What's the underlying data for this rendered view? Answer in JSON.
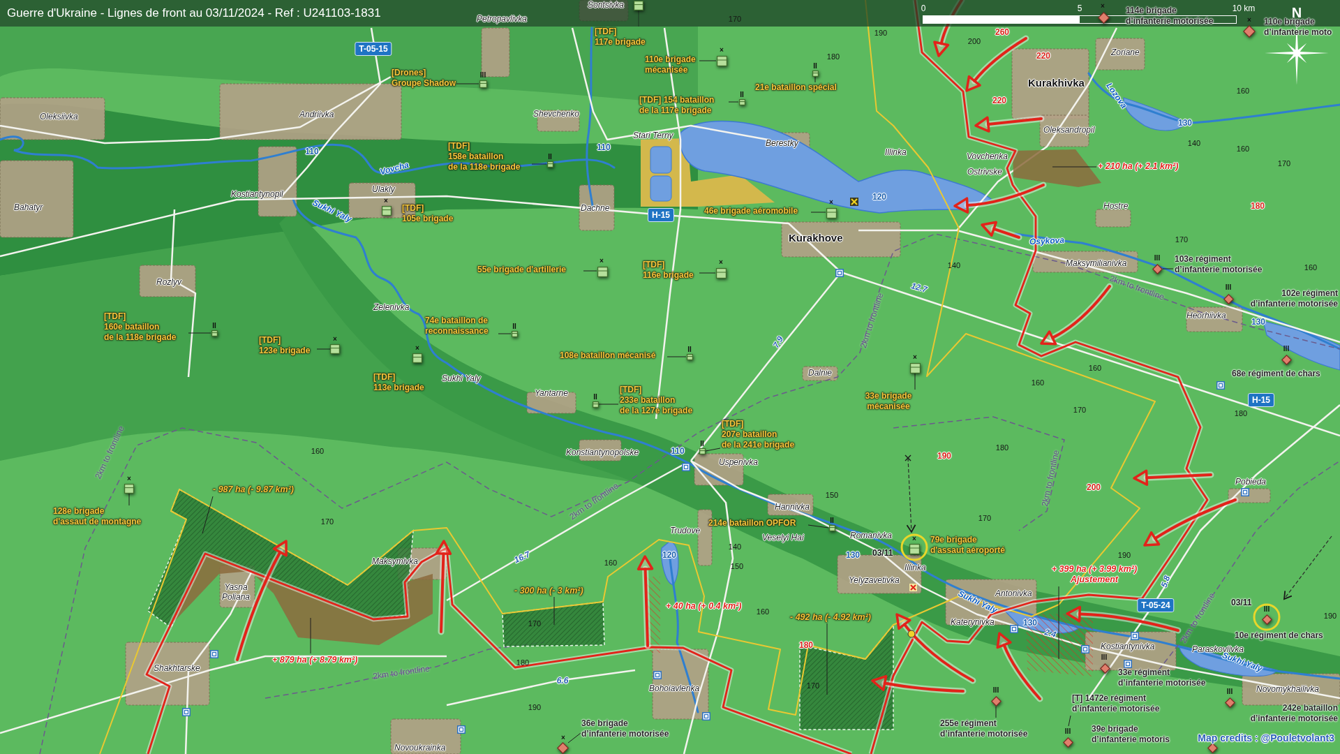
{
  "title": "Guerre d'Ukraine - Lignes de front au 03/11/2024 - Ref : U241103-1831",
  "scale_bar": {
    "ticks": [
      "0",
      "5",
      "10 km"
    ]
  },
  "compass": {
    "label": "N"
  },
  "places": [
    {
      "name": "Sontsivka",
      "kind": "village"
    },
    {
      "name": "Petropavlivka",
      "kind": "village"
    },
    {
      "name": "Oleksiivka",
      "kind": "village"
    },
    {
      "name": "Andriivka",
      "kind": "village"
    },
    {
      "name": "Shevchenko",
      "kind": "village"
    },
    {
      "name": "Stari Terny",
      "kind": "village"
    },
    {
      "name": "Berestky",
      "kind": "village"
    },
    {
      "name": "Illinka",
      "kind": "village"
    },
    {
      "name": "Zoriane",
      "kind": "village"
    },
    {
      "name": "Kurakhivka",
      "kind": "city"
    },
    {
      "name": "Oleksandropil",
      "kind": "village"
    },
    {
      "name": "Vovchenka",
      "kind": "village"
    },
    {
      "name": "Ostrivske",
      "kind": "village"
    },
    {
      "name": "Ulakly",
      "kind": "village"
    },
    {
      "name": "Kostiantynopil",
      "kind": "village"
    },
    {
      "name": "Bahatyr",
      "kind": "village"
    },
    {
      "name": "Dachne",
      "kind": "village"
    },
    {
      "name": "Hostre",
      "kind": "village"
    },
    {
      "name": "Kurakhove",
      "kind": "city"
    },
    {
      "name": "Maksymilianivka",
      "kind": "village"
    },
    {
      "name": "Rozlyv",
      "kind": "village"
    },
    {
      "name": "Zelenivka",
      "kind": "village"
    },
    {
      "name": "Heorhiivka",
      "kind": "village"
    },
    {
      "name": "Dalnie",
      "kind": "village"
    },
    {
      "name": "Sukhi Yaly",
      "kind": "village"
    },
    {
      "name": "Yantarne",
      "kind": "village"
    },
    {
      "name": "Konstiantynopolske",
      "kind": "village"
    },
    {
      "name": "Uspenivka",
      "kind": "village"
    },
    {
      "name": "Pobieda",
      "kind": "village"
    },
    {
      "name": "Hannivka",
      "kind": "village"
    },
    {
      "name": "Trudove",
      "kind": "village"
    },
    {
      "name": "Romanivka",
      "kind": "village"
    },
    {
      "name": "Veselyi Hai",
      "kind": "village"
    },
    {
      "name": "Maksymivka",
      "kind": "village"
    },
    {
      "name": "Illinka",
      "kind": "village"
    },
    {
      "name": "Yelyzavetivka",
      "kind": "village"
    },
    {
      "name": "Yasna Poliana",
      "kind": "village"
    },
    {
      "name": "Antonivka",
      "kind": "village"
    },
    {
      "name": "Katerynivka",
      "kind": "village"
    },
    {
      "name": "Kostiantynivka",
      "kind": "village"
    },
    {
      "name": "Paraskoviivka",
      "kind": "village"
    },
    {
      "name": "Shakhtarske",
      "kind": "village"
    },
    {
      "name": "Bohoiavlenka",
      "kind": "village"
    },
    {
      "name": "Novomykhailivka",
      "kind": "village"
    },
    {
      "name": "Novoukrainka",
      "kind": "village"
    }
  ],
  "elevations": [
    {
      "value": "170",
      "kind": "contour"
    },
    {
      "value": "190",
      "kind": "contour"
    },
    {
      "value": "260",
      "kind": "spot"
    },
    {
      "value": "200",
      "kind": "contour"
    },
    {
      "value": "220",
      "kind": "spot"
    },
    {
      "value": "180",
      "kind": "contour"
    },
    {
      "value": "160",
      "kind": "contour"
    },
    {
      "value": "220",
      "kind": "spot"
    },
    {
      "value": "140",
      "kind": "contour"
    },
    {
      "value": "160",
      "kind": "contour"
    },
    {
      "value": "170",
      "kind": "contour"
    },
    {
      "value": "180",
      "kind": "spot"
    },
    {
      "value": "170",
      "kind": "contour"
    },
    {
      "value": "140",
      "kind": "contour"
    },
    {
      "value": "160",
      "kind": "contour"
    },
    {
      "value": "160",
      "kind": "contour"
    },
    {
      "value": "160",
      "kind": "contour"
    },
    {
      "value": "170",
      "kind": "contour"
    },
    {
      "value": "180",
      "kind": "contour"
    },
    {
      "value": "180",
      "kind": "contour"
    },
    {
      "value": "160",
      "kind": "contour"
    },
    {
      "value": "190",
      "kind": "spot"
    },
    {
      "value": "200",
      "kind": "spot"
    },
    {
      "value": "150",
      "kind": "contour"
    },
    {
      "value": "170",
      "kind": "contour"
    },
    {
      "value": "170",
      "kind": "contour"
    },
    {
      "value": "140",
      "kind": "contour"
    },
    {
      "value": "190",
      "kind": "contour"
    },
    {
      "value": "160",
      "kind": "contour"
    },
    {
      "value": "150",
      "kind": "contour"
    },
    {
      "value": "160",
      "kind": "contour"
    },
    {
      "value": "190",
      "kind": "contour"
    },
    {
      "value": "170",
      "kind": "contour"
    },
    {
      "value": "180",
      "kind": "spot"
    },
    {
      "value": "180",
      "kind": "contour"
    },
    {
      "value": "170",
      "kind": "contour"
    },
    {
      "value": "190",
      "kind": "contour"
    }
  ],
  "road_numbers": [
    {
      "label": "T-05-15",
      "kind": "shield"
    },
    {
      "label": "130",
      "kind": "local"
    },
    {
      "label": "110",
      "kind": "local"
    },
    {
      "label": "110",
      "kind": "local"
    },
    {
      "label": "120",
      "kind": "local"
    },
    {
      "label": "H-15",
      "kind": "shield"
    },
    {
      "label": "12.7",
      "kind": "distance"
    },
    {
      "label": "130",
      "kind": "local"
    },
    {
      "label": "7.9",
      "kind": "distance"
    },
    {
      "label": "H-15",
      "kind": "shield"
    },
    {
      "label": "110",
      "kind": "local"
    },
    {
      "label": "120",
      "kind": "local"
    },
    {
      "label": "130",
      "kind": "local"
    },
    {
      "label": "16.7",
      "kind": "distance"
    },
    {
      "label": "5.8",
      "kind": "distance"
    },
    {
      "label": "T-05-24",
      "kind": "shield"
    },
    {
      "label": "130",
      "kind": "local"
    },
    {
      "label": "2.4",
      "kind": "distance"
    },
    {
      "label": "6.6",
      "kind": "distance"
    }
  ],
  "rivers": [
    {
      "label": "Lozova"
    },
    {
      "label": "Vovcha"
    },
    {
      "label": "Sukhi Yaly"
    },
    {
      "label": "Osykova"
    },
    {
      "label": "Sukhi Yaly"
    },
    {
      "label": "Sukhi Yaly"
    }
  ],
  "frontline_labels": [
    "2km to frontline",
    "2km to frontline",
    "2km to frontline",
    "2km to frontline",
    "2km to frontline",
    "2km to frontline",
    "2km to frontline"
  ],
  "units": [
    {
      "kind": "russia",
      "echelon": "×",
      "lines": [
        "114e brigade",
        "d’infanterie motorisée"
      ],
      "highlighted": false
    },
    {
      "kind": "russia",
      "echelon": "×",
      "lines": [
        "110e brigade",
        "d’infanterie moto"
      ],
      "highlighted": false
    },
    {
      "kind": "ukraine",
      "lines": [
        "[TDF]",
        "117e brigade"
      ],
      "highlighted": false
    },
    {
      "kind": "ukraine",
      "echelon": "×",
      "lines": [
        "110e brigade",
        "mécanisée"
      ],
      "highlighted": false
    },
    {
      "kind": "ukraine",
      "echelon": "III",
      "lines": [
        "[Drones]",
        "Groupe Shadow"
      ],
      "highlighted": false
    },
    {
      "kind": "ukraine",
      "echelon": "II",
      "lines": [
        "21e bataillon spécial"
      ],
      "highlighted": false
    },
    {
      "kind": "ukraine",
      "echelon": "II",
      "lines": [
        "[TDF] 154 bataillon",
        "de la 117e brigade"
      ],
      "highlighted": false
    },
    {
      "kind": "ukraine",
      "echelon": "II",
      "lines": [
        "[TDF]",
        "158e bataillon",
        "de la 118e brigade"
      ],
      "highlighted": false
    },
    {
      "kind": "ukraine",
      "echelon": "×",
      "lines": [
        "[TDF]",
        "105e brigade"
      ],
      "highlighted": false
    },
    {
      "kind": "ukraine",
      "echelon": "×",
      "lines": [
        "46e brigade aéromobile"
      ],
      "highlighted": false
    },
    {
      "kind": "ukraine",
      "echelon": "×",
      "lines": [
        "55e brigade d'artillerie"
      ],
      "highlighted": false
    },
    {
      "kind": "ukraine",
      "echelon": "×",
      "lines": [
        "[TDF]",
        "116e brigade"
      ],
      "highlighted": false
    },
    {
      "kind": "russia",
      "echelon": "III",
      "lines": [
        "103e régiment",
        "d’infanterie motorisée"
      ],
      "highlighted": false
    },
    {
      "kind": "russia",
      "echelon": "III",
      "lines": [
        "102e régiment",
        "d’infanterie motorisée"
      ],
      "highlighted": false
    },
    {
      "kind": "ukraine",
      "echelon": "II",
      "lines": [
        "[TDF]",
        "160e bataillon",
        "de la 118e brigade"
      ],
      "highlighted": false
    },
    {
      "kind": "ukraine",
      "echelon": "II",
      "lines": [
        "74e bataillon de",
        "reconnaissance"
      ],
      "highlighted": false
    },
    {
      "kind": "ukraine",
      "echelon": "×",
      "lines": [
        "[TDF]",
        "123e brigade"
      ],
      "highlighted": false
    },
    {
      "kind": "ukraine",
      "echelon": "×",
      "lines": [
        "[TDF]",
        "113e brigade"
      ],
      "highlighted": false
    },
    {
      "kind": "ukraine",
      "echelon": "II",
      "lines": [
        "108e bataillon mécanisé"
      ],
      "highlighted": false
    },
    {
      "kind": "russia",
      "echelon": "III",
      "lines": [
        "68e régiment de chars"
      ],
      "highlighted": false
    },
    {
      "kind": "ukraine",
      "echelon": "II",
      "lines": [
        "[TDF]",
        "233e bataillon",
        "de la 127e brigade"
      ],
      "highlighted": false
    },
    {
      "kind": "ukraine",
      "echelon": "×",
      "lines": [
        "33e brigade",
        "mécanisée"
      ],
      "highlighted": false
    },
    {
      "kind": "ukraine",
      "echelon": "II",
      "lines": [
        "[TDF]",
        "207e bataillon",
        "de la 241e brigade"
      ],
      "highlighted": false
    },
    {
      "kind": "ukraine",
      "echelon": "×",
      "lines": [
        "128e brigade",
        "d'assaut de montagne"
      ],
      "highlighted": false
    },
    {
      "kind": "ukraine",
      "echelon": "II",
      "lines": [
        "214e bataillon OPFOR"
      ],
      "highlighted": false
    },
    {
      "kind": "ukraine",
      "echelon": "×",
      "lines": [
        "79e brigade",
        "d'assaut aéroporté"
      ],
      "highlighted": true,
      "date": "03/11"
    },
    {
      "kind": "russia",
      "echelon": "III",
      "lines": [
        "10e régiment de chars"
      ],
      "highlighted": true,
      "date": "03/11"
    },
    {
      "kind": "russia",
      "echelon": "III",
      "lines": [
        "33e régiment",
        "d’infanterie motorisée"
      ],
      "highlighted": false
    },
    {
      "kind": "russia",
      "echelon": "III",
      "lines": [
        "[T] 1472e régiment",
        "d’infanterie motorisée"
      ],
      "highlighted": false
    },
    {
      "kind": "russia",
      "echelon": "III",
      "lines": [
        "242e bataillon",
        "d’infanterie motorisée"
      ],
      "highlighted": false
    },
    {
      "kind": "russia",
      "echelon": "×",
      "lines": [
        "36e brigade",
        "d’infanterie motorisée"
      ],
      "highlighted": false
    },
    {
      "kind": "russia",
      "echelon": "III",
      "lines": [
        "255e régiment",
        "d’infanterie motorisée"
      ],
      "highlighted": false
    },
    {
      "kind": "russia",
      "lines": [
        "39e brigade",
        "d’infanterie motoris"
      ],
      "highlighted": false
    }
  ],
  "area_changes": [
    {
      "kind": "gain",
      "lines": [
        "+ 210 ha (+ 2.1 km²)"
      ]
    },
    {
      "kind": "loss",
      "lines": [
        "- 987 ha (- 9.87 km²)"
      ]
    },
    {
      "kind": "gain",
      "lines": [
        "+ 399 ha (+ 3.99 km²)",
        "Ajustement"
      ]
    },
    {
      "kind": "loss",
      "lines": [
        "- 300 ha (- 3 km²)"
      ]
    },
    {
      "kind": "gain",
      "lines": [
        "+ 40 ha (+ 0.4 km²)"
      ]
    },
    {
      "kind": "loss",
      "lines": [
        "- 492 ha (- 4.92 km²)"
      ]
    },
    {
      "kind": "gain",
      "lines": [
        "+ 879 ha (+ 8.79 km²)"
      ]
    }
  ],
  "credits": "Map credits : @Pouletvolant3"
}
